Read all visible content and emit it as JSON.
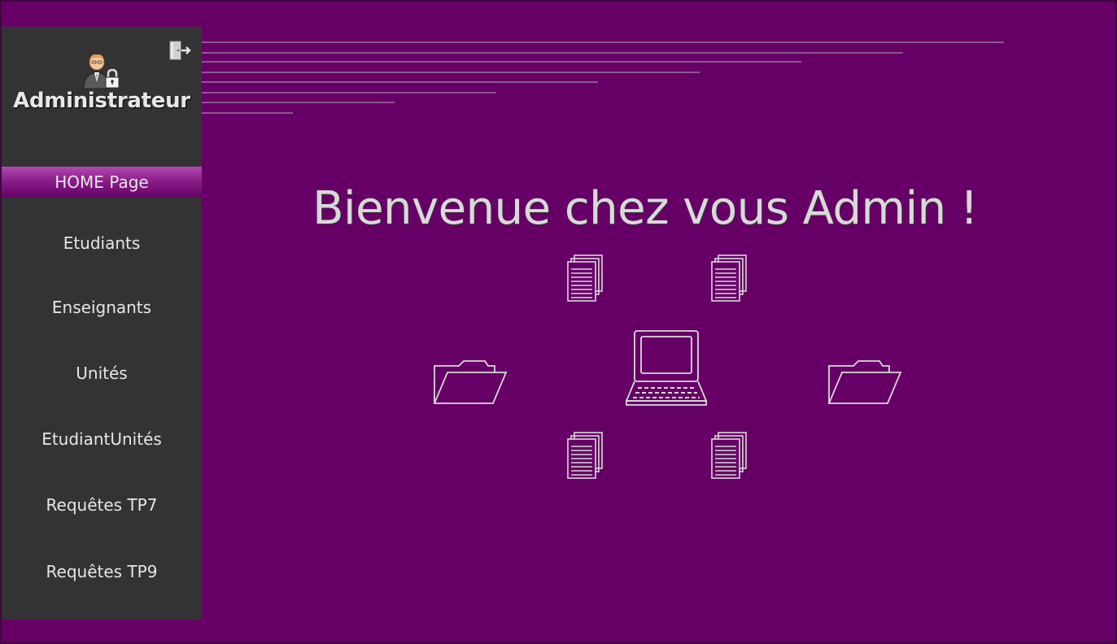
{
  "sidebar": {
    "role_title": "Administrateur",
    "avatar_icon": "admin-user-lock-icon",
    "logout_icon": "logout-door-icon",
    "nav_items": [
      {
        "label": "HOME Page",
        "active": true
      },
      {
        "label": "Etudiants",
        "active": false
      },
      {
        "label": "Enseignants",
        "active": false
      },
      {
        "label": "Unités",
        "active": false
      },
      {
        "label": "EtudiantUnités",
        "active": false
      },
      {
        "label": "Requêtes TP7",
        "active": false
      },
      {
        "label": "Requêtes TP9",
        "active": false
      }
    ]
  },
  "main": {
    "welcome_text": "Bienvenue chez vous Admin !",
    "illustration_icons": [
      "documents-icon",
      "folder-icon",
      "laptop-icon"
    ]
  },
  "colors": {
    "background": "#660066",
    "sidebar": "#333333",
    "text": "#d9d9d9",
    "active_item": "#8a1f8a"
  }
}
